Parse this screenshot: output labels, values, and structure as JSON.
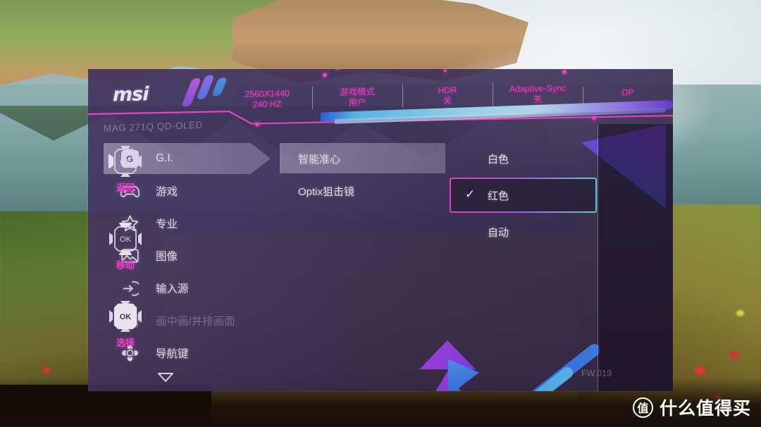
{
  "osd": {
    "brand": "msi",
    "model": "MAG 271Q QD-OLED",
    "firmware": "FW.019",
    "header_items": [
      {
        "line1": "2560X1440",
        "line2": "240 HZ"
      },
      {
        "line1": "游戏模式",
        "line2": "用户"
      },
      {
        "line1": "HDR",
        "line2": "关"
      },
      {
        "line1": "Adaptive-Sync",
        "line2": "关"
      },
      {
        "line1": "DP",
        "line2": ""
      }
    ],
    "menu": [
      {
        "label": "G.I.",
        "icon": "gi-badge-icon",
        "state": "active"
      },
      {
        "label": "游戏",
        "icon": "gamepad-icon",
        "state": "normal"
      },
      {
        "label": "专业",
        "icon": "star-icon",
        "state": "normal"
      },
      {
        "label": "图像",
        "icon": "image-icon",
        "state": "normal"
      },
      {
        "label": "输入源",
        "icon": "input-source-icon",
        "state": "normal"
      },
      {
        "label": "画中画/并排画面",
        "icon": "pip-pbp-icon",
        "state": "disabled"
      },
      {
        "label": "导航键",
        "icon": "navigation-key-icon",
        "state": "normal"
      }
    ],
    "menu_more_icon": "chevron-down-icon",
    "submenu": [
      {
        "label": "智能准心",
        "state": "highlighted"
      },
      {
        "label": "Optix狙击镜",
        "state": "normal"
      }
    ],
    "values": [
      {
        "label": "白色",
        "selected": false
      },
      {
        "label": "红色",
        "selected": true
      },
      {
        "label": "自动",
        "selected": false
      }
    ],
    "hints": [
      {
        "label": "返回",
        "icon": "nav-back-icon"
      },
      {
        "label": "移动",
        "icon": "nav-move-icon"
      },
      {
        "label": "选择",
        "icon": "nav-select-icon"
      }
    ],
    "check_glyph": "✓",
    "ok_label": "OK"
  },
  "watermark": {
    "badge": "值",
    "text": "什么值得买"
  },
  "colors": {
    "accent_magenta": "#ff3fd0",
    "accent_cyan": "#6fd9f2",
    "panel": "#3a2c58",
    "text": "#f4f1fc"
  }
}
